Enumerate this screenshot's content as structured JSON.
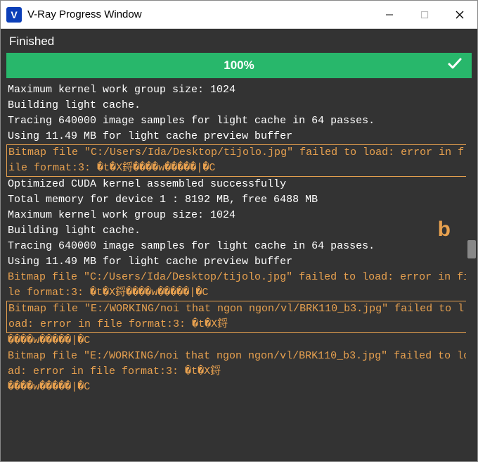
{
  "window": {
    "title": "V-Ray Progress Window"
  },
  "status": {
    "label": "Finished",
    "progress_text": "100%"
  },
  "annotation": {
    "b": "b"
  },
  "log": {
    "lines": [
      {
        "text": "Maximum kernel work group size: 1024",
        "type": "info"
      },
      {
        "text": "Building light cache.",
        "type": "info"
      },
      {
        "text": "Tracing 640000 image samples for light cache in 64 passes.",
        "type": "info"
      },
      {
        "text": "Using 11.49 MB for light cache preview buffer",
        "type": "info"
      },
      {
        "text": "Bitmap file \"C:/Users/Ida/Desktop/tijolo.jpg\" failed to load: error in file format:3: �t�X鋝����w�����|�C",
        "type": "err1"
      },
      {
        "text": "Optimized CUDA kernel assembled successfully",
        "type": "info"
      },
      {
        "text": "Total memory for device 1 : 8192 MB, free 6488 MB",
        "type": "info"
      },
      {
        "text": "Maximum kernel work group size: 1024",
        "type": "info"
      },
      {
        "text": "Building light cache.",
        "type": "info"
      },
      {
        "text": "Tracing 640000 image samples for light cache in 64 passes.",
        "type": "info"
      },
      {
        "text": "Using 11.49 MB for light cache preview buffer",
        "type": "info"
      },
      {
        "text": "Bitmap file \"C:/Users/Ida/Desktop/tijolo.jpg\" failed to load: error in file format:3: �t�X鋝����w�����|�C",
        "type": "warn"
      },
      {
        "text": "Bitmap file \"E:/WORKING/noi that ngon ngon/vl/BRK110_b3.jpg\" failed to load: error in file format:3: �t�X鋝",
        "type": "err2"
      },
      {
        "text": "����w�����|�C",
        "type": "warn"
      },
      {
        "text": "Bitmap file \"E:/WORKING/noi that ngon ngon/vl/BRK110_b3.jpg\" failed to load: error in file format:3: �t�X鋝",
        "type": "warn"
      },
      {
        "text": "����w�����|�C",
        "type": "warn"
      }
    ]
  }
}
